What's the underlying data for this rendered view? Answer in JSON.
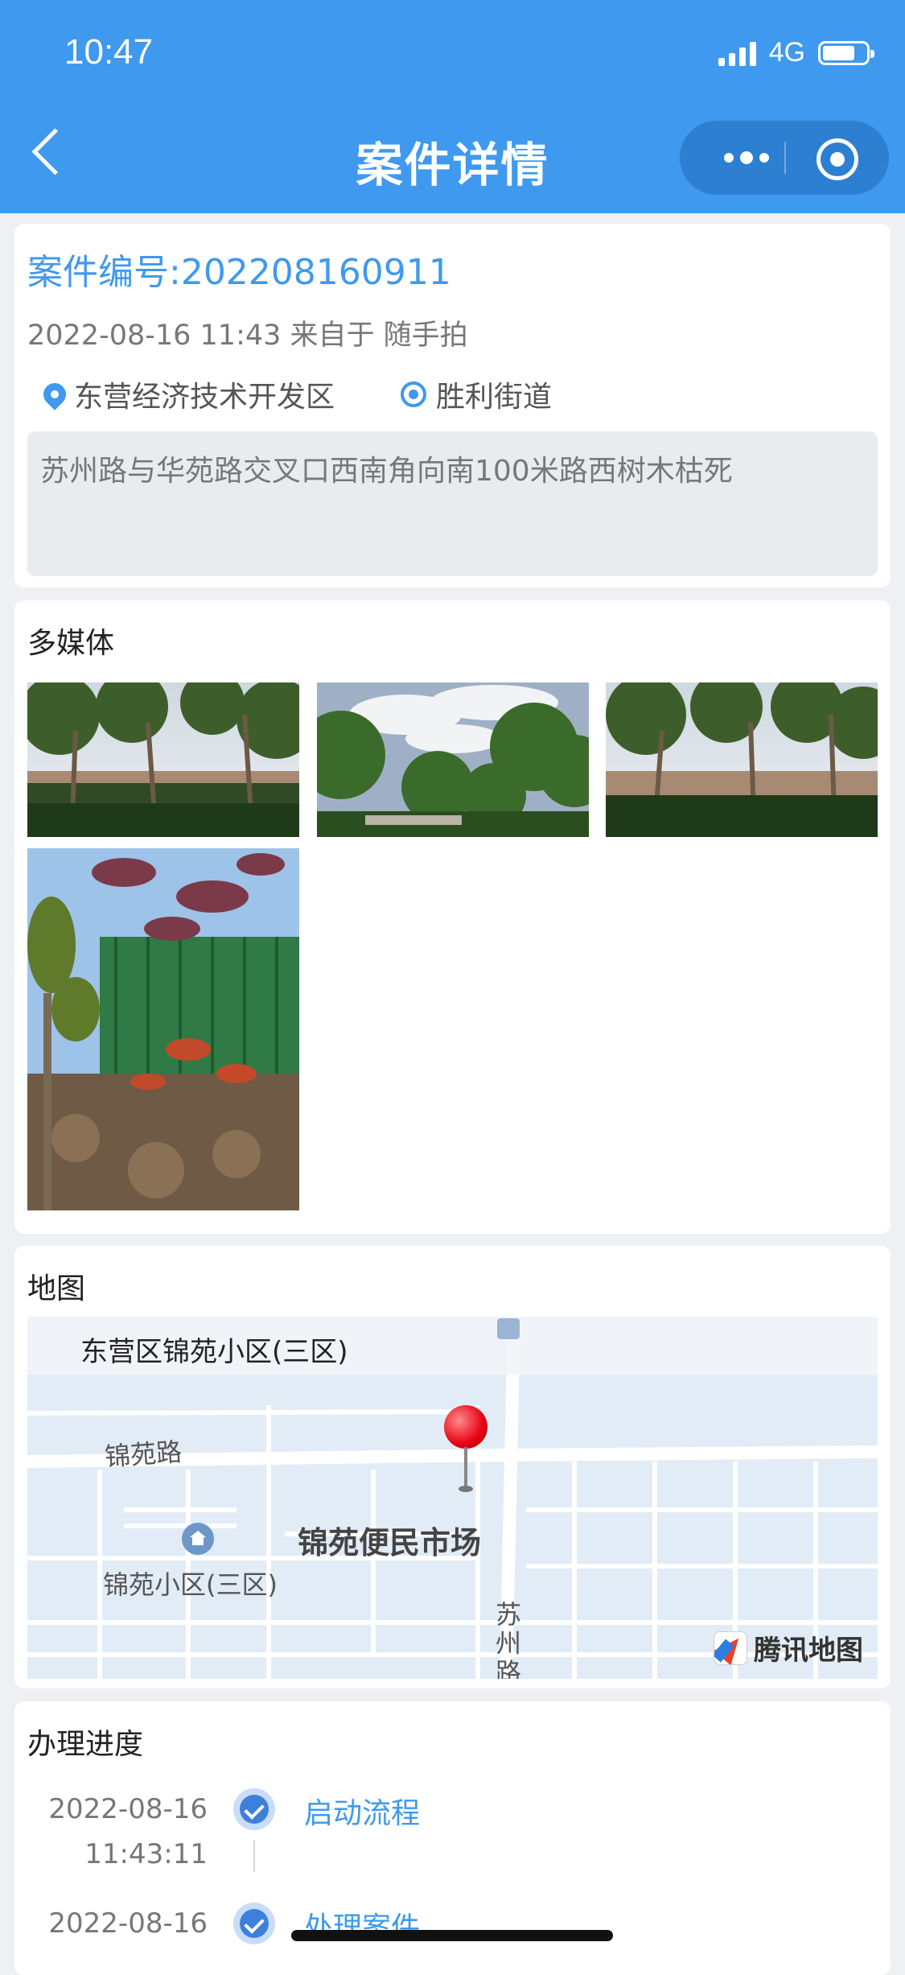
{
  "status_bar": {
    "time": "10:47",
    "network": "4G",
    "battery_level": 0.75
  },
  "nav": {
    "title": "案件详情"
  },
  "case": {
    "number_label": "案件编号:202208160911",
    "meta": "2022-08-16 11:43 来自于 随手拍",
    "district": "东营经济技术开发区",
    "street": "胜利街道",
    "description": "苏州路与华苑路交叉口西南角向南100米路西树木枯死"
  },
  "media": {
    "title": "多媒体",
    "photo_count": 4
  },
  "map": {
    "title": "地图",
    "top_label": "东营区锦苑小区(三区)",
    "road_jinyuan": "锦苑路",
    "market": "锦苑便民市场",
    "community": "锦苑小区(三区)",
    "road_suzhou": "苏州路",
    "provider": "腾讯地图"
  },
  "progress": {
    "title": "办理进度",
    "steps": [
      {
        "date": "2022-08-16",
        "time": "11:43:11",
        "label": "启动流程"
      },
      {
        "date": "2022-08-16",
        "time": "",
        "label": "处理案件"
      }
    ]
  }
}
